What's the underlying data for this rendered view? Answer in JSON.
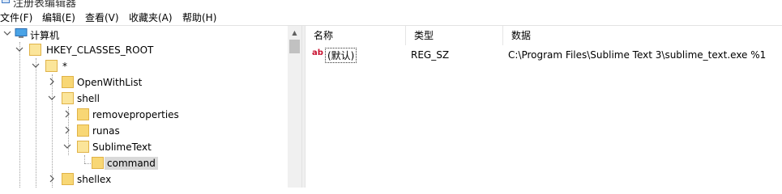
{
  "window": {
    "title": "注册表编辑器"
  },
  "menu": [
    {
      "label": "文件(F)"
    },
    {
      "label": "编辑(E)"
    },
    {
      "label": "查看(V)"
    },
    {
      "label": "收藏夹(A)"
    },
    {
      "label": "帮助(H)"
    }
  ],
  "tree": {
    "root": "计算机",
    "hkcr": "HKEY_CLASSES_ROOT",
    "star": "*",
    "openwithlist": "OpenWithList",
    "shell": "shell",
    "removeproperties": "removeproperties",
    "runas": "runas",
    "sublimetext": "SublimeText",
    "command": "command",
    "shellex": "shellex"
  },
  "list": {
    "columns": [
      "名称",
      "类型",
      "数据"
    ],
    "rows": [
      {
        "name": "(默认)",
        "type": "REG_SZ",
        "data": "C:\\Program Files\\Sublime Text 3\\sublime_text.exe %1"
      }
    ]
  },
  "icons": {
    "value_icon": "ab-string-icon",
    "folder_color": "#f8d775"
  }
}
